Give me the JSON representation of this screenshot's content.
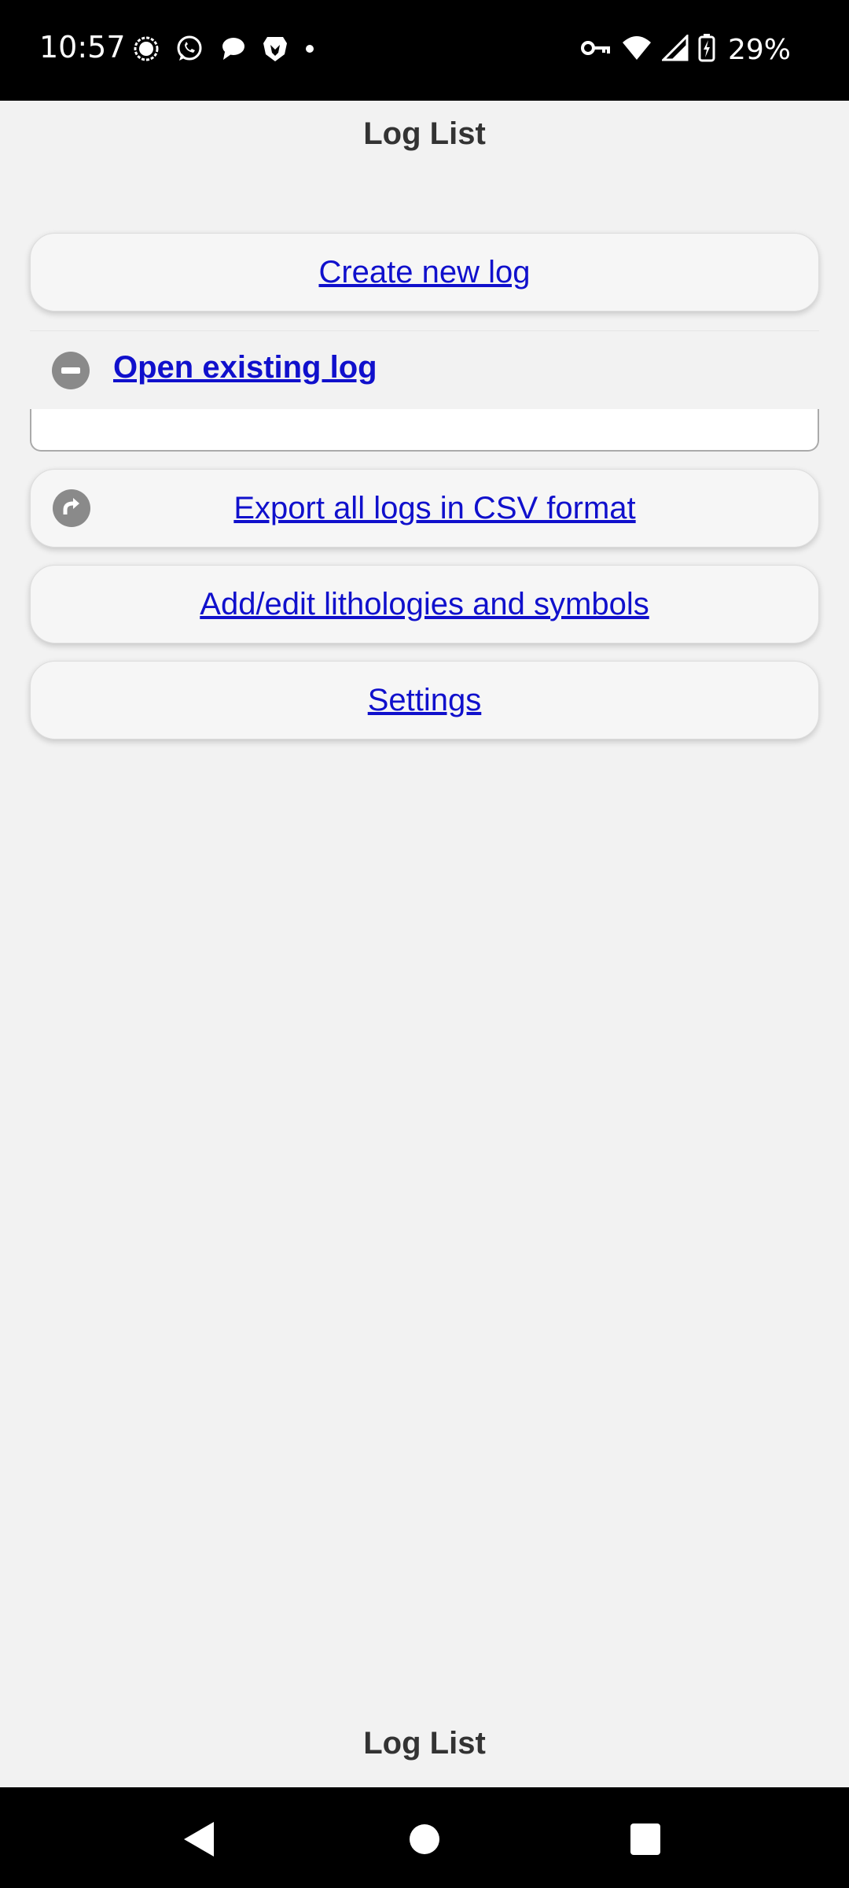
{
  "status_bar": {
    "time": "10:57",
    "left_icons": [
      "signal-app-icon",
      "whatsapp-icon",
      "chat-bubble-icon",
      "brave-icon",
      "dot-icon"
    ],
    "right_icons": [
      "vpn-key-icon",
      "wifi-icon",
      "cell-signal-icon",
      "battery-charging-icon"
    ],
    "battery": "29%"
  },
  "header": {
    "title": "Log List"
  },
  "menu": {
    "create_label": "Create new log",
    "open_label": "Open existing log",
    "export_label": "Export all logs in CSV format",
    "lithologies_label": "Add/edit lithologies and symbols",
    "settings_label": "Settings"
  },
  "footer": {
    "title": "Log List"
  },
  "nav_bar": {
    "icons": [
      "back-icon",
      "home-icon",
      "recents-icon"
    ]
  },
  "colors": {
    "link": "#1010cc",
    "background": "#f2f2f2",
    "icon_gray": "#8a8a8a"
  }
}
